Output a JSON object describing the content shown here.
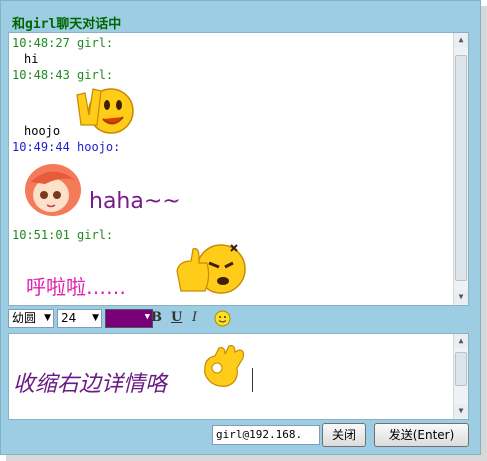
{
  "window": {
    "title": "和girl聊天对话中"
  },
  "history": [
    {
      "time": "10:48:27 girl:",
      "sender": "girl",
      "text": "hi"
    },
    {
      "time": "10:48:43 girl:",
      "sender": "girl",
      "emoticon": "victory-smiley-icon",
      "text": "hoojo"
    },
    {
      "time": "10:49:44 hoojo:",
      "sender": "hoojo",
      "emoticon": "girl-avatar-icon",
      "text": "haha~~"
    },
    {
      "time": "10:51:01 girl:",
      "sender": "girl",
      "text": "呼啦啦……",
      "emoticon": "thumbs-up-smiley-icon"
    }
  ],
  "toolbar": {
    "font": "幼圆",
    "size": "24",
    "color": "#7a007a",
    "bold": "B",
    "underline": "U",
    "italic": "I",
    "emoticon_icon": "smiley-icon"
  },
  "input": {
    "text": "收缩右边详情咯",
    "emoticon": "ok-hand-icon"
  },
  "footer": {
    "address": "girl@192.168.",
    "close_label": "关闭",
    "send_label": "发送(Enter)"
  },
  "colors": {
    "frame": "#9ccde2",
    "girl": "#1c8a1c",
    "hoojo": "#1e1ec8",
    "title": "#006600"
  }
}
